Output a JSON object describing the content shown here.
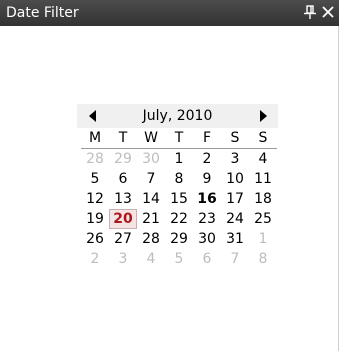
{
  "window": {
    "title": "Date Filter",
    "pin_icon": "pin-icon",
    "close_icon": "close-icon"
  },
  "calendar": {
    "month_label": "July, 2010",
    "weekdays": [
      "M",
      "T",
      "W",
      "T",
      "F",
      "S",
      "S"
    ],
    "weeks": [
      [
        "28",
        "29",
        "30",
        "1",
        "2",
        "3",
        "4"
      ],
      [
        "5",
        "6",
        "7",
        "8",
        "9",
        "10",
        "11"
      ],
      [
        "12",
        "13",
        "14",
        "15",
        "16",
        "17",
        "18"
      ],
      [
        "19",
        "20",
        "21",
        "22",
        "23",
        "24",
        "25"
      ],
      [
        "26",
        "27",
        "28",
        "29",
        "30",
        "31",
        "1"
      ],
      [
        "2",
        "3",
        "4",
        "5",
        "6",
        "7",
        "8"
      ]
    ],
    "bold_date": "16",
    "selected_date": "20",
    "colors": {
      "header_bg": "#f0f0f0",
      "other_month": "#bdbdbd",
      "selected": "#b0151b",
      "titlebar": "#3d3d3d"
    }
  }
}
